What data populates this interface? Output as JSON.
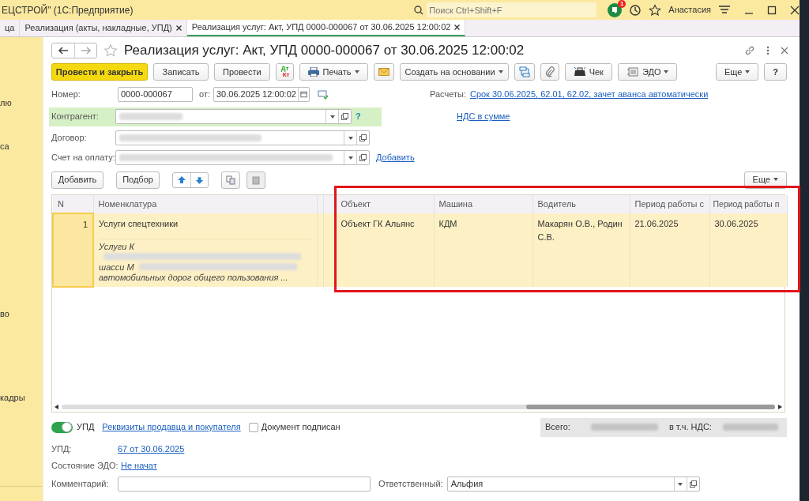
{
  "title_bar": {
    "title": "ЕЦСТРОЙ\" (1С:Предприятие)",
    "search_placeholder": "Поиск Ctrl+Shift+F",
    "notification_count": "1",
    "user": "Анастасия"
  },
  "tabs": [
    {
      "label": "ца",
      "selected": false,
      "closable": false
    },
    {
      "label": "Реализация (акты, накладные, УПД)",
      "selected": false,
      "closable": true
    },
    {
      "label": "Реализация услуг: Акт, УПД 0000-000067 от 30.06.2025 12:00:02",
      "selected": true,
      "closable": true
    }
  ],
  "sidebar": {
    "items": [
      "лю",
      "са",
      "во",
      "кадры"
    ]
  },
  "form": {
    "title": "Реализация услуг: Акт, УПД 0000-000067 от 30.06.2025 12:00:02",
    "toolbar": [
      {
        "kind": "primary",
        "label": "Провести и закрыть"
      },
      {
        "kind": "plain",
        "label": "Записать"
      },
      {
        "kind": "plain",
        "label": "Провести"
      },
      {
        "kind": "dtkt",
        "label": "Дт",
        "label2": "Кт"
      },
      {
        "kind": "print",
        "label": "Печать"
      },
      {
        "kind": "mail"
      },
      {
        "kind": "create",
        "label": "Создать на основании"
      },
      {
        "kind": "structure"
      },
      {
        "kind": "clip"
      },
      {
        "kind": "receipt",
        "label": "Чек"
      },
      {
        "kind": "edo",
        "label": "ЭДО"
      },
      {
        "kind": "more",
        "label": "Еще"
      },
      {
        "kind": "help",
        "label": "?"
      }
    ],
    "number_label": "Номер:",
    "number": "0000-000067",
    "date_label": "от:",
    "date": "30.06.2025 12:00:02",
    "settlements_label": "Расчеты:",
    "settlements_link": "Срок 30.06.2025, 62.01, 62.02, зачет аванса автоматически",
    "counterparty_label": "Контрагент:",
    "help_mark": "?",
    "vat_link": "НДС в сумме",
    "contract_label": "Договор:",
    "invoice_label": "Счет на оплату:",
    "add_link": "Добавить",
    "table_buttons": [
      "Добавить",
      "Подбор"
    ],
    "table_more": "Еще",
    "table": {
      "columns": [
        "N",
        "Номенклатура",
        "Объект",
        "Машина",
        "Водитель",
        "Период работы с",
        "Период работы п"
      ],
      "rows": [
        {
          "n": "1",
          "item": "Услуги спецтехники",
          "description": [
            "Услуги К",
            "шасси М",
            "автомобильных дорог общего пользования ..."
          ],
          "object": "Объект ГК Альянс",
          "machine": "КДМ",
          "driver": "Макарян О.В., Родин С.В.",
          "from": "21.06.2025",
          "to": "30.06.2025",
          "selected": true
        }
      ]
    },
    "upd_switch": {
      "label": "УПД",
      "on": true
    },
    "requisites_link": "Реквизиты продавца и покупателя",
    "signed": {
      "label": "Документ подписан",
      "checked": false
    },
    "total_label": "Всего:",
    "vat_label": "в т.ч. НДС:",
    "upd_label": "УПД:",
    "upd_link": "67 от 30.06.2025",
    "edo_label": "Состояние ЭДО:",
    "edo_link": "Не начат",
    "comment_label": "Комментарий:",
    "responsible_label": "Ответственный:",
    "responsible": "Альфия"
  }
}
